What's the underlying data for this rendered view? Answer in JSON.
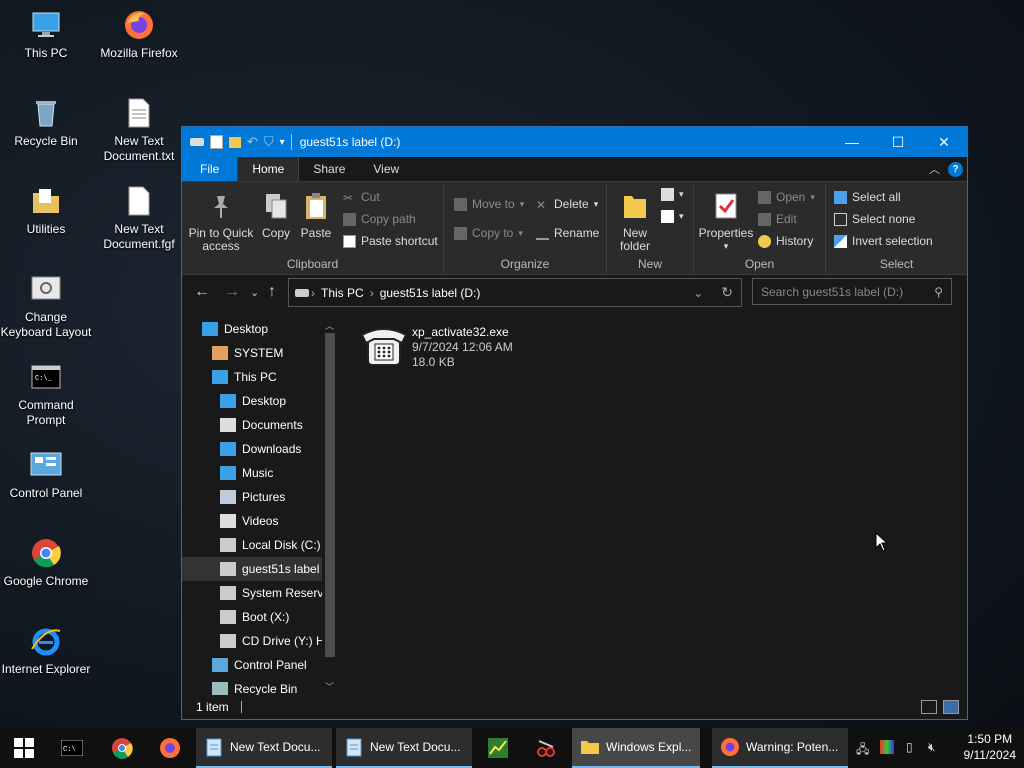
{
  "desktop": {
    "icons": [
      {
        "label": "This PC"
      },
      {
        "label": "Mozilla Firefox"
      },
      {
        "label": "Recycle Bin"
      },
      {
        "label": "New Text Document.txt"
      },
      {
        "label": "Utilities"
      },
      {
        "label": "New Text Document.fgf"
      },
      {
        "label": "Change Keyboard Layout"
      },
      {
        "label": "Command Prompt"
      },
      {
        "label": "Control Panel"
      },
      {
        "label": "Google Chrome"
      },
      {
        "label": "Internet Explorer"
      }
    ]
  },
  "window": {
    "title": "guest51s label (D:)",
    "menu": {
      "file": "File",
      "home": "Home",
      "share": "Share",
      "view": "View"
    },
    "ribbon": {
      "clipboard": {
        "label": "Clipboard",
        "pin": "Pin to Quick access",
        "copy": "Copy",
        "paste": "Paste",
        "cut": "Cut",
        "copy_path": "Copy path",
        "paste_shortcut": "Paste shortcut"
      },
      "organize": {
        "label": "Organize",
        "move_to": "Move to",
        "copy_to": "Copy to",
        "delete": "Delete",
        "rename": "Rename"
      },
      "new": {
        "label": "New",
        "new_folder": "New folder"
      },
      "open": {
        "label": "Open",
        "properties": "Properties",
        "open": "Open",
        "edit": "Edit",
        "history": "History"
      },
      "select": {
        "label": "Select",
        "select_all": "Select all",
        "select_none": "Select none",
        "invert_selection": "Invert selection"
      }
    },
    "address": {
      "crumbs": [
        "This PC",
        "guest51s label (D:)"
      ]
    },
    "search": {
      "placeholder": "Search guest51s label (D:)"
    },
    "nav_items": [
      {
        "label": "Desktop",
        "indent": 0
      },
      {
        "label": "SYSTEM",
        "indent": 1
      },
      {
        "label": "This PC",
        "indent": 1
      },
      {
        "label": "Desktop",
        "indent": 2
      },
      {
        "label": "Documents",
        "indent": 2
      },
      {
        "label": "Downloads",
        "indent": 2
      },
      {
        "label": "Music",
        "indent": 2
      },
      {
        "label": "Pictures",
        "indent": 2
      },
      {
        "label": "Videos",
        "indent": 2
      },
      {
        "label": "Local Disk (C:)",
        "indent": 2
      },
      {
        "label": "guest51s label",
        "indent": 2,
        "selected": true
      },
      {
        "label": "System Reserve",
        "indent": 2
      },
      {
        "label": "Boot (X:)",
        "indent": 2
      },
      {
        "label": "CD Drive (Y:) H",
        "indent": 2
      },
      {
        "label": "Control Panel",
        "indent": 1
      },
      {
        "label": "Recycle Bin",
        "indent": 1
      }
    ],
    "files": [
      {
        "name": "xp_activate32.exe",
        "date": "9/7/2024 12:06 AM",
        "size": "18.0 KB"
      }
    ],
    "status": {
      "count": "1 item"
    }
  },
  "taskbar": {
    "tasks": [
      {
        "label": "New Text Docu..."
      },
      {
        "label": "New Text Docu..."
      },
      {
        "label": "Windows Expl..."
      },
      {
        "label": "Warning: Poten..."
      }
    ],
    "clock": {
      "time": "1:50 PM",
      "date": "9/11/2024"
    }
  },
  "colors": {
    "accent": "#0078d7",
    "window_bg": "#191919",
    "ribbon_bg": "#2b2b2b"
  }
}
